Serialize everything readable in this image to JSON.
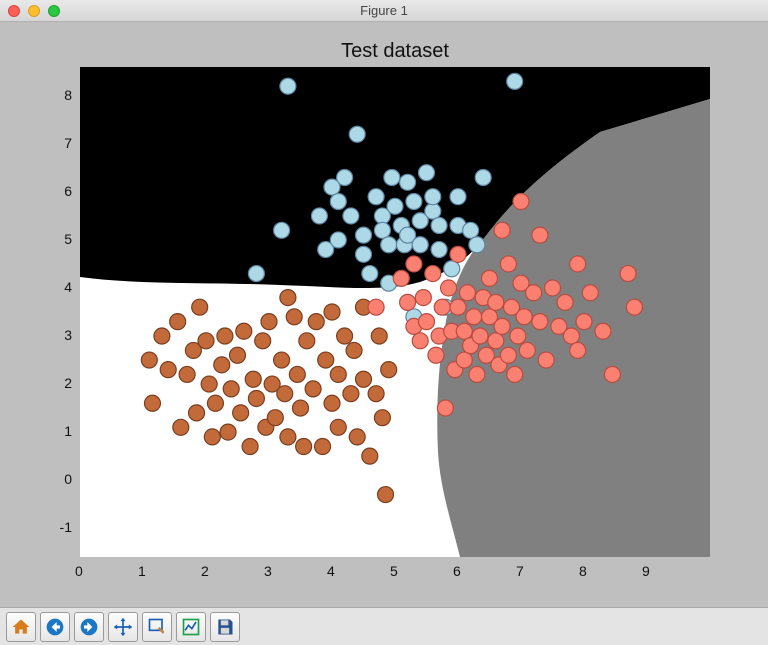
{
  "window": {
    "title": "Figure 1"
  },
  "toolbar": {
    "buttons": [
      {
        "name": "home-button",
        "icon": "home-icon"
      },
      {
        "name": "back-button",
        "icon": "left-arrow-icon"
      },
      {
        "name": "forward-button",
        "icon": "right-arrow-icon"
      },
      {
        "name": "pan-button",
        "icon": "move-icon"
      },
      {
        "name": "zoom-button",
        "icon": "zoom-icon"
      },
      {
        "name": "subplots-button",
        "icon": "subplots-icon"
      },
      {
        "name": "save-button",
        "icon": "floppy-icon"
      }
    ]
  },
  "chart_data": {
    "type": "scatter",
    "title": "Test dataset",
    "xlabel": "",
    "ylabel": "",
    "xlim": [
      0,
      10
    ],
    "ylim": [
      -1.6,
      8.6
    ],
    "xticks": [
      0,
      1,
      2,
      3,
      4,
      5,
      6,
      7,
      8,
      9
    ],
    "yticks": [
      -1,
      0,
      1,
      2,
      3,
      4,
      5,
      6,
      7,
      8
    ],
    "background_regions": [
      {
        "class": "black",
        "color": "#000000",
        "note": "upper region"
      },
      {
        "class": "white",
        "color": "#ffffff",
        "note": "lower-left region"
      },
      {
        "class": "gray",
        "color": "#808080",
        "note": "right region"
      }
    ],
    "series": [
      {
        "name": "blue",
        "color": "#add8e6",
        "edge": "#5c84a0",
        "points": [
          [
            3.3,
            8.2
          ],
          [
            4.4,
            7.2
          ],
          [
            4.2,
            6.3
          ],
          [
            3.8,
            5.5
          ],
          [
            3.2,
            5.2
          ],
          [
            2.8,
            4.3
          ],
          [
            3.9,
            4.8
          ],
          [
            4.0,
            6.1
          ],
          [
            4.1,
            5.8
          ],
          [
            4.3,
            5.5
          ],
          [
            4.5,
            5.1
          ],
          [
            4.5,
            4.7
          ],
          [
            4.6,
            4.3
          ],
          [
            4.7,
            5.9
          ],
          [
            4.8,
            5.5
          ],
          [
            4.8,
            5.2
          ],
          [
            4.9,
            4.9
          ],
          [
            4.95,
            6.3
          ],
          [
            5.0,
            5.7
          ],
          [
            5.1,
            5.3
          ],
          [
            5.15,
            4.9
          ],
          [
            5.2,
            5.1
          ],
          [
            5.2,
            6.2
          ],
          [
            5.3,
            5.8
          ],
          [
            5.4,
            5.4
          ],
          [
            5.4,
            4.9
          ],
          [
            5.5,
            6.4
          ],
          [
            5.6,
            5.6
          ],
          [
            5.6,
            5.9
          ],
          [
            5.7,
            5.3
          ],
          [
            5.7,
            4.8
          ],
          [
            5.8,
            3.6
          ],
          [
            5.9,
            4.4
          ],
          [
            6.0,
            5.3
          ],
          [
            6.0,
            5.9
          ],
          [
            6.2,
            5.2
          ],
          [
            6.3,
            4.9
          ],
          [
            6.4,
            6.3
          ],
          [
            6.9,
            8.3
          ],
          [
            5.3,
            3.4
          ],
          [
            4.9,
            4.1
          ],
          [
            4.1,
            5.0
          ]
        ]
      },
      {
        "name": "brown",
        "color": "#c26a3a",
        "edge": "#7a3e20",
        "points": [
          [
            1.1,
            2.5
          ],
          [
            1.15,
            1.6
          ],
          [
            1.4,
            2.3
          ],
          [
            1.55,
            3.3
          ],
          [
            1.6,
            1.1
          ],
          [
            1.7,
            2.2
          ],
          [
            1.8,
            2.7
          ],
          [
            1.85,
            1.4
          ],
          [
            2.0,
            2.9
          ],
          [
            2.05,
            2.0
          ],
          [
            2.1,
            0.9
          ],
          [
            2.15,
            1.6
          ],
          [
            2.25,
            2.4
          ],
          [
            2.3,
            3.0
          ],
          [
            2.35,
            1.0
          ],
          [
            2.4,
            1.9
          ],
          [
            2.5,
            2.6
          ],
          [
            2.55,
            1.4
          ],
          [
            2.6,
            3.1
          ],
          [
            2.7,
            0.7
          ],
          [
            2.75,
            2.1
          ],
          [
            2.8,
            1.7
          ],
          [
            2.9,
            2.9
          ],
          [
            2.95,
            1.1
          ],
          [
            3.0,
            3.3
          ],
          [
            3.05,
            2.0
          ],
          [
            3.1,
            1.3
          ],
          [
            3.2,
            2.5
          ],
          [
            3.25,
            1.8
          ],
          [
            3.3,
            0.9
          ],
          [
            3.4,
            3.4
          ],
          [
            3.45,
            2.2
          ],
          [
            3.5,
            1.5
          ],
          [
            3.55,
            0.7
          ],
          [
            3.6,
            2.9
          ],
          [
            3.7,
            1.9
          ],
          [
            3.75,
            3.3
          ],
          [
            3.85,
            0.7
          ],
          [
            3.9,
            2.5
          ],
          [
            4.0,
            1.6
          ],
          [
            4.1,
            1.1
          ],
          [
            4.1,
            2.2
          ],
          [
            4.2,
            3.0
          ],
          [
            4.3,
            1.8
          ],
          [
            4.35,
            2.7
          ],
          [
            4.4,
            0.9
          ],
          [
            4.5,
            2.1
          ],
          [
            4.6,
            0.5
          ],
          [
            4.7,
            1.8
          ],
          [
            4.75,
            3.0
          ],
          [
            4.8,
            1.3
          ],
          [
            4.85,
            -0.3
          ],
          [
            4.9,
            2.3
          ],
          [
            1.3,
            3.0
          ],
          [
            1.9,
            3.6
          ],
          [
            3.3,
            3.8
          ],
          [
            4.0,
            3.5
          ],
          [
            4.5,
            3.6
          ]
        ]
      },
      {
        "name": "salmon",
        "color": "#fa8072",
        "edge": "#b84c3f",
        "points": [
          [
            5.1,
            4.2
          ],
          [
            5.2,
            3.7
          ],
          [
            5.3,
            3.2
          ],
          [
            5.4,
            2.9
          ],
          [
            5.45,
            3.8
          ],
          [
            5.5,
            3.3
          ],
          [
            5.6,
            4.3
          ],
          [
            5.65,
            2.6
          ],
          [
            5.7,
            3.0
          ],
          [
            5.75,
            3.6
          ],
          [
            5.8,
            1.5
          ],
          [
            5.85,
            4.0
          ],
          [
            5.9,
            3.1
          ],
          [
            5.95,
            2.3
          ],
          [
            6.0,
            3.6
          ],
          [
            6.1,
            3.1
          ],
          [
            6.1,
            2.5
          ],
          [
            6.15,
            3.9
          ],
          [
            6.2,
            2.8
          ],
          [
            6.25,
            3.4
          ],
          [
            6.3,
            2.2
          ],
          [
            6.35,
            3.0
          ],
          [
            6.4,
            3.8
          ],
          [
            6.45,
            2.6
          ],
          [
            6.5,
            3.4
          ],
          [
            6.6,
            2.9
          ],
          [
            6.6,
            3.7
          ],
          [
            6.65,
            2.4
          ],
          [
            6.7,
            3.2
          ],
          [
            6.8,
            2.6
          ],
          [
            6.8,
            4.5
          ],
          [
            6.85,
            3.6
          ],
          [
            6.9,
            2.2
          ],
          [
            6.95,
            3.0
          ],
          [
            7.0,
            4.1
          ],
          [
            7.0,
            5.8
          ],
          [
            7.05,
            3.4
          ],
          [
            7.1,
            2.7
          ],
          [
            7.2,
            3.9
          ],
          [
            7.3,
            3.3
          ],
          [
            7.4,
            2.5
          ],
          [
            7.5,
            4.0
          ],
          [
            7.6,
            3.2
          ],
          [
            7.7,
            3.7
          ],
          [
            7.8,
            3.0
          ],
          [
            7.9,
            4.5
          ],
          [
            7.9,
            2.7
          ],
          [
            8.0,
            3.3
          ],
          [
            8.1,
            3.9
          ],
          [
            8.3,
            3.1
          ],
          [
            8.45,
            2.2
          ],
          [
            8.7,
            4.3
          ],
          [
            8.8,
            3.6
          ],
          [
            5.3,
            4.5
          ],
          [
            4.7,
            3.6
          ],
          [
            6.0,
            4.7
          ],
          [
            6.5,
            4.2
          ],
          [
            7.3,
            5.1
          ],
          [
            6.7,
            5.2
          ]
        ]
      }
    ]
  }
}
